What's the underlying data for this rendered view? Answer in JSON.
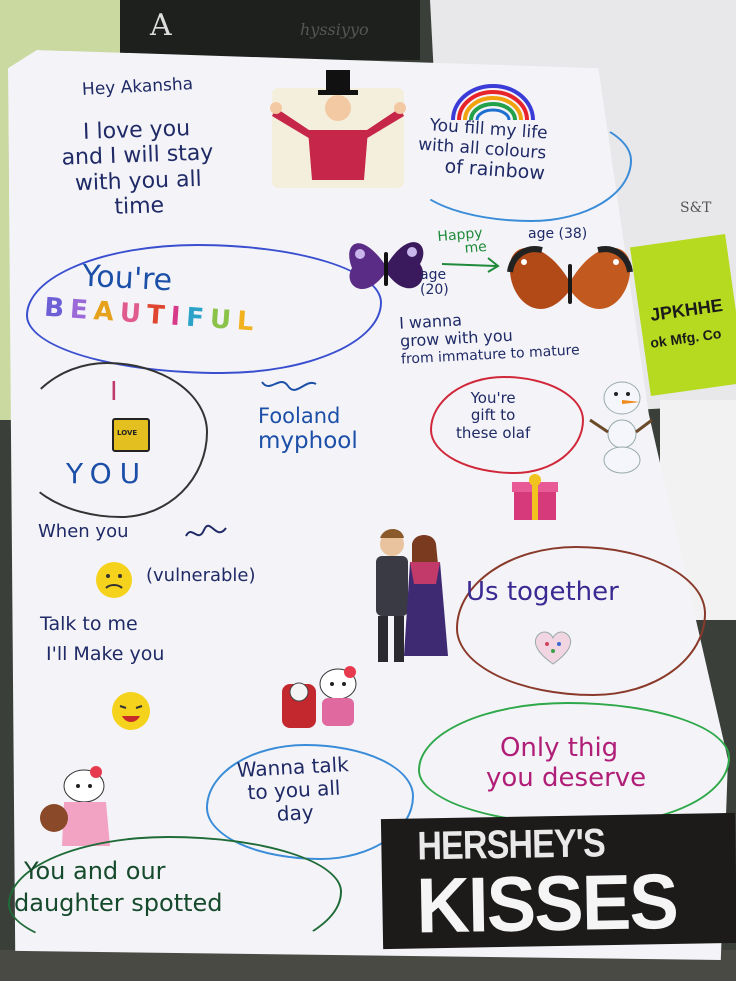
{
  "background": {
    "dark_paper_text": "A",
    "sheet_scribble": "hyssiyyo",
    "sheet_right_text": "S&T",
    "tag_text_1": "JPKHHE",
    "tag_text_2": "ok Mfg. Co"
  },
  "card": {
    "greeting": "Hey Akansha",
    "love_lines": [
      "I love you",
      "and I will stay",
      "with you all",
      "time"
    ],
    "rainbow_lines": [
      "You fill my life",
      "with all colours",
      "of rainbow"
    ],
    "happy_me": [
      "Happy",
      "me"
    ],
    "age_right": "age (38)",
    "age_left": [
      "age",
      "(20)"
    ],
    "grow_lines": [
      "I wanna",
      "grow with you",
      "from immature to mature"
    ],
    "youre": "You're",
    "beautiful_letters": [
      "B",
      "E",
      "A",
      "U",
      "T",
      "I",
      "F",
      "U",
      "L"
    ],
    "i_letter": "I",
    "love_badge": "LOVE",
    "you_word": "YOU",
    "fool_lines": [
      "Fooland",
      "myphool"
    ],
    "gift_lines": [
      "You're",
      "gift to",
      "these olaf"
    ],
    "vulnerable_lines": [
      "When you",
      "(vulnerable)"
    ],
    "talk_lines": [
      "Talk to me",
      "I'll Make you"
    ],
    "together": "Us together",
    "wanna_talk": [
      "Wanna talk",
      "to you all",
      "day"
    ],
    "only_thing": [
      "Only thig",
      "you deserve"
    ],
    "daughter_lines": [
      "You and our",
      "daughter spotted"
    ]
  },
  "candy": {
    "brand": "HERSHEY'S",
    "product": "KISSES"
  },
  "colors": {
    "ink_navy": "#1f2a66",
    "ink_blue": "#1c4fa8",
    "ink_purple": "#3a2a92",
    "ink_magenta": "#b01e78",
    "ink_green": "#164a2c",
    "paper": "#f4f4f8"
  },
  "icons": [
    "magician-sticker",
    "rainbow-drawing",
    "purple-butterfly-sticker",
    "orange-butterfly-sticker",
    "olaf-sticker",
    "gift-sticker",
    "couple-sticker",
    "heart-sticker",
    "hello-kitty-sticker",
    "smiley-sticker",
    "emoji-sticker"
  ]
}
